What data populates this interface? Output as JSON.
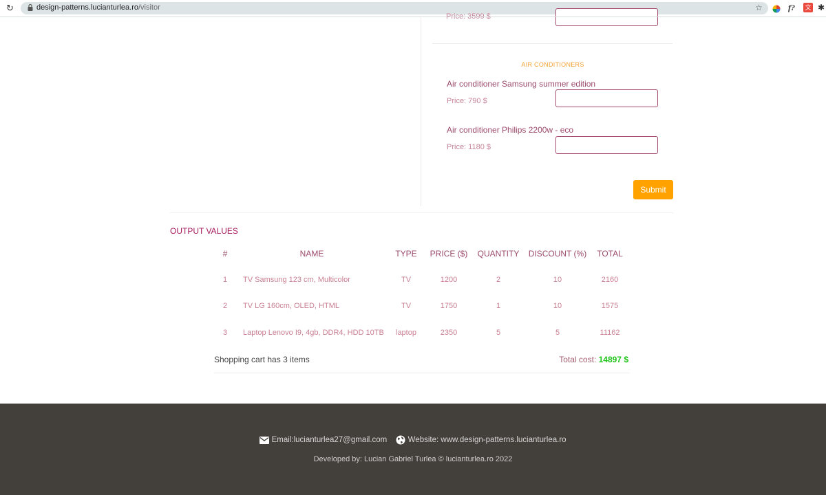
{
  "browser": {
    "url_host": "design-patterns.lucianturlea.ro",
    "url_path": "/visitor"
  },
  "products": {
    "prev_price": "Price: 3599 $",
    "category": "AIR CONDITIONERS",
    "items": [
      {
        "name": "Air conditioner Samsung summer edition",
        "price": "Price: 790 $",
        "quantity": ""
      },
      {
        "name": "Air conditioner Philips 2200w - eco",
        "price": "Price: 1180 $",
        "quantity": ""
      }
    ],
    "submit_label": "Submit"
  },
  "output": {
    "title": "OUTPUT VALUES",
    "headers": [
      "#",
      "NAME",
      "TYPE",
      "PRICE ($)",
      "QUANTITY",
      "DISCOUNT (%)",
      "TOTAL"
    ],
    "rows": [
      [
        "1",
        "TV Samsung 123 cm, Multicolor",
        "TV",
        "1200",
        "2",
        "10",
        "2160"
      ],
      [
        "2",
        "TV LG 160cm, OLED, HTML",
        "TV",
        "1750",
        "1",
        "10",
        "1575"
      ],
      [
        "3",
        "Laptop Lenovo I9, 4gb, DDR4, HDD 10TB",
        "laptop",
        "2350",
        "5",
        "5",
        "11162"
      ]
    ],
    "cart_info": "Shopping cart has 3 items",
    "total_label": "Total cost: ",
    "total_value": "14897 $"
  },
  "footer": {
    "email": "Email:lucianturlea27@gmail.com",
    "website": "Website: www.design-patterns.lucianturlea.ro",
    "developed": "Developed by: Lucian Gabriel Turlea © lucianturlea.ro 2022"
  },
  "colors": {
    "accent": "#ffa200",
    "label": "#9c4a6b",
    "title": "#a6195c",
    "total": "#1ec417",
    "footer_bg": "#433f3a"
  }
}
